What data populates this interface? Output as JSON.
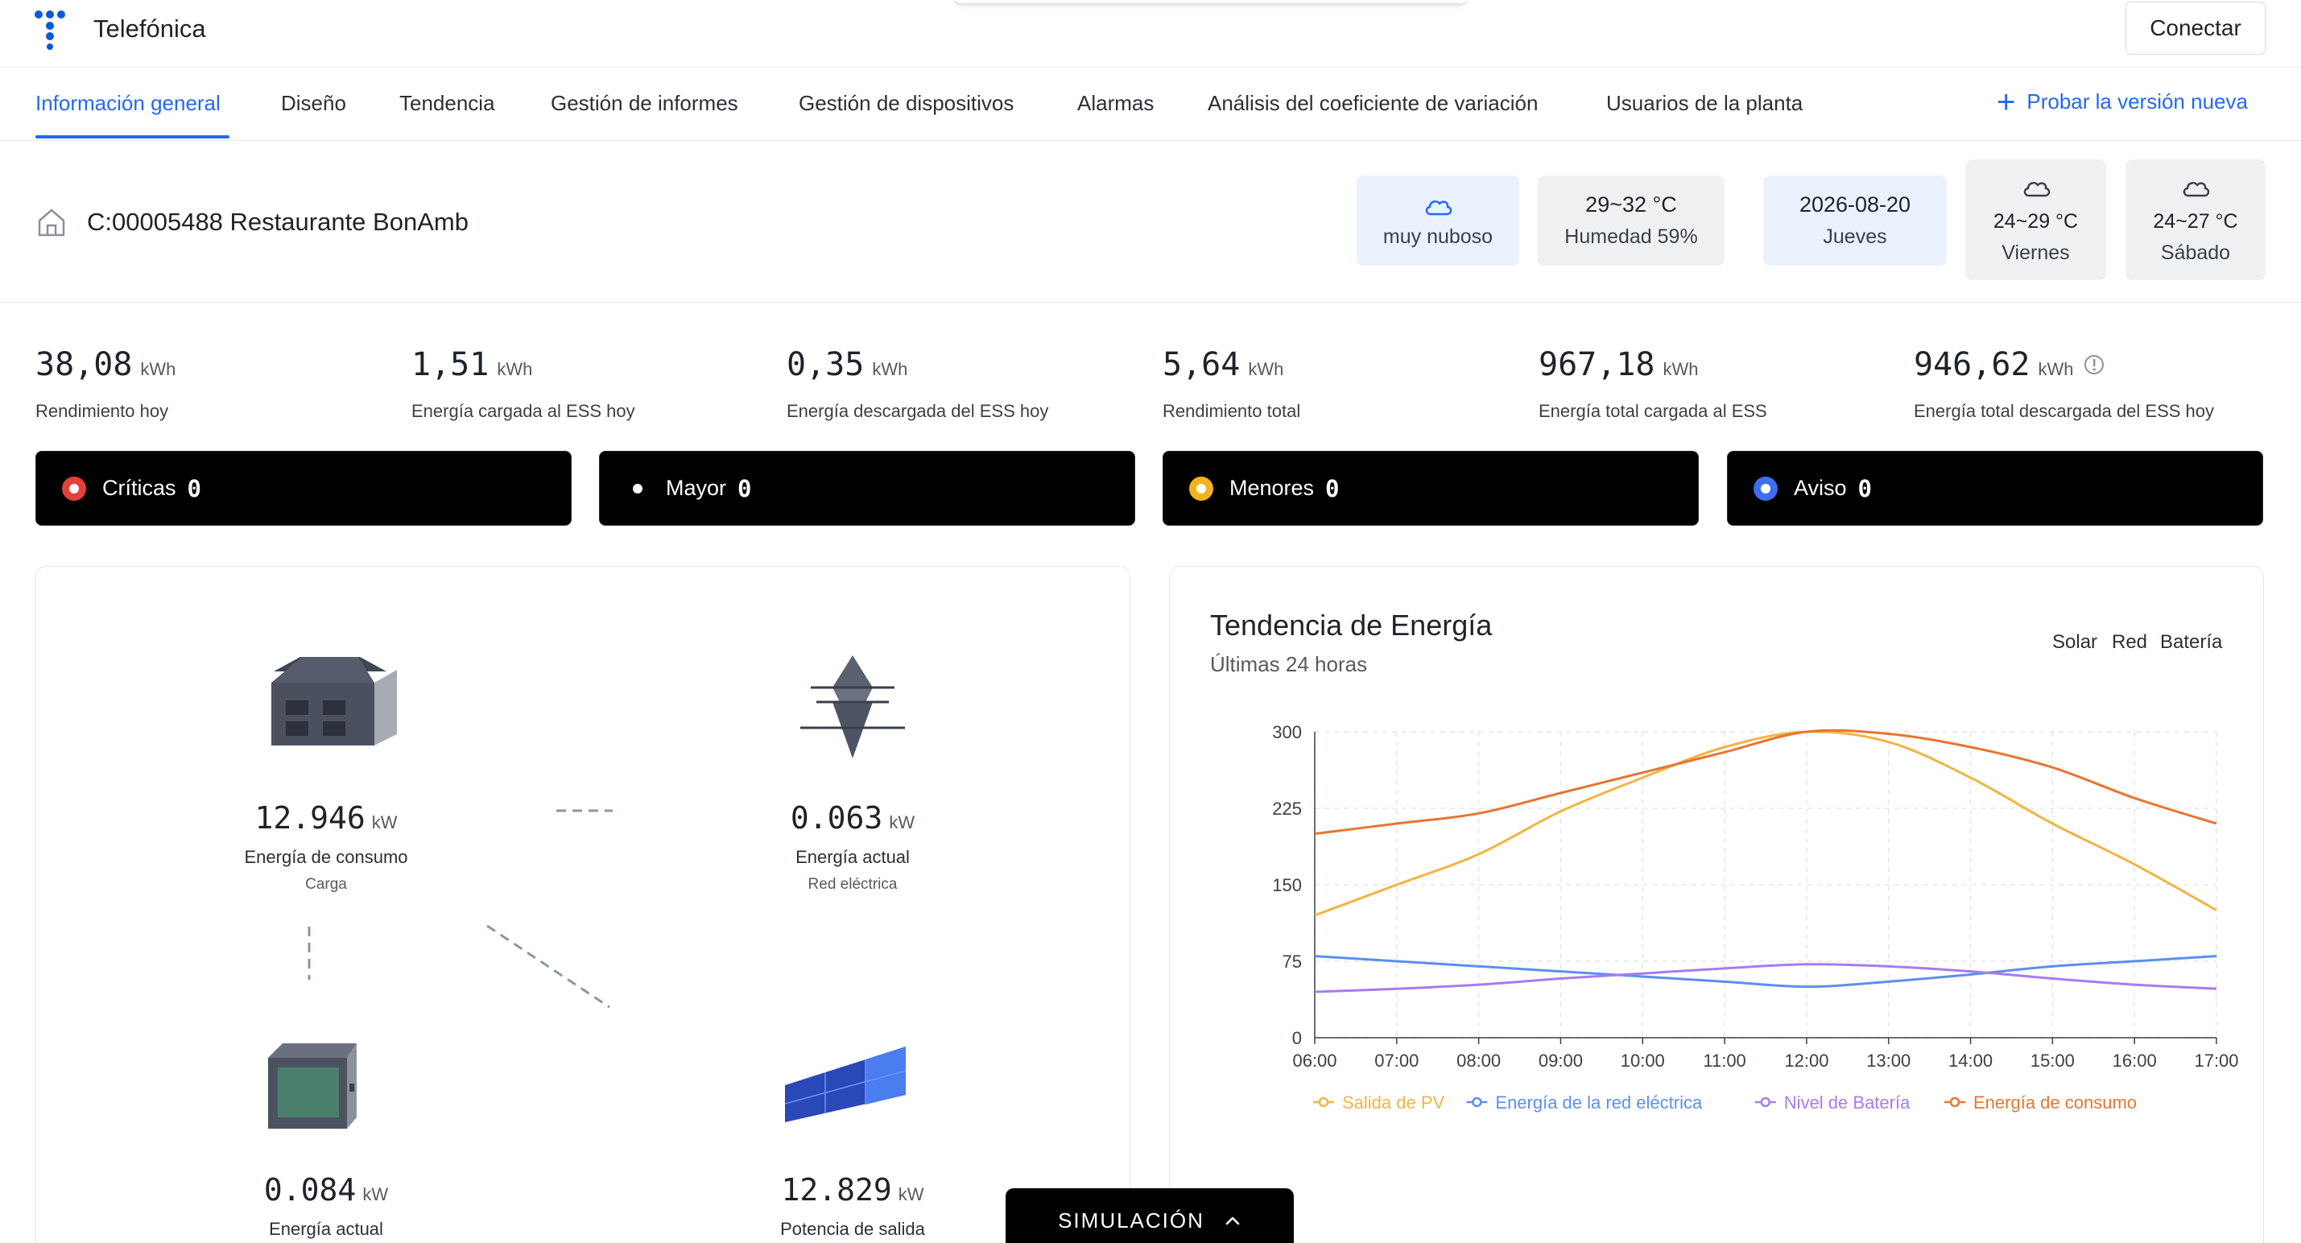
{
  "app": {
    "brand": "Telefónica",
    "connect_label": "Conectar"
  },
  "tabs": [
    {
      "label": "Información general",
      "active": true
    },
    {
      "label": "Diseño"
    },
    {
      "label": "Tendencia"
    },
    {
      "label": "Gestión de informes"
    },
    {
      "label": "Gestión de dispositivos"
    },
    {
      "label": "Alarmas"
    },
    {
      "label": "Análisis del coeficiente de variación"
    },
    {
      "label": "Usuarios de la planta"
    }
  ],
  "try_new_label": "Probar la versión nueva",
  "plant": {
    "name": "C:00005488 Restaurante BonAmb"
  },
  "weather": {
    "today_icon": "cloud-icon",
    "today_condition": "muy nuboso",
    "temp_range": "29~32 °C",
    "humidity": "Humedad 59%",
    "date": "2026-08-20",
    "weekday": "Jueves",
    "forecast": [
      {
        "icon": "cloud-icon",
        "temp": "24~29 °C",
        "day": "Viernes"
      },
      {
        "icon": "cloud-icon",
        "temp": "24~27 °C",
        "day": "Sábado"
      }
    ]
  },
  "stats": [
    {
      "value": "38,08",
      "unit": "kWh",
      "label": "Rendimiento hoy"
    },
    {
      "value": "1,51",
      "unit": "kWh",
      "label": "Energía cargada al ESS hoy"
    },
    {
      "value": "0,35",
      "unit": "kWh",
      "label": "Energía descargada del ESS hoy"
    },
    {
      "value": "5,64",
      "unit": "kWh",
      "label": "Rendimiento total"
    },
    {
      "value": "967,18",
      "unit": "kWh",
      "label": "Energía total cargada al ESS"
    },
    {
      "value": "946,62",
      "unit": "kWh",
      "label": "Energía total descargada del ESS hoy"
    }
  ],
  "alarms": [
    {
      "label": "Críticas",
      "count": "0",
      "color": "#e5403a"
    },
    {
      "label": "Mayor",
      "count": "0",
      "color": "#000000"
    },
    {
      "label": "Menores",
      "count": "0",
      "color": "#f1b21c"
    },
    {
      "label": "Aviso",
      "count": "0",
      "color": "#3d6ff5"
    }
  ],
  "flow": {
    "load": {
      "value": "12.946",
      "unit": "kW",
      "label": "Energía de consumo",
      "sublabel": "Carga"
    },
    "grid": {
      "value": "0.063",
      "unit": "kW",
      "label": "Energía actual",
      "sublabel": "Red eléctrica"
    },
    "battery": {
      "value": "0.084",
      "unit": "kW",
      "label": "Energía actual"
    },
    "pv": {
      "value": "12.829",
      "unit": "kW",
      "label": "Potencia de salida"
    }
  },
  "chart_toggles": [
    "Solar",
    "Red",
    "Batería"
  ],
  "simulation_label": "SIMULACIÓN",
  "chart_data": {
    "type": "line",
    "title": "Tendencia de Energía",
    "subtitle": "Últimas 24 horas",
    "x": [
      "06:00",
      "07:00",
      "08:00",
      "09:00",
      "10:00",
      "11:00",
      "12:00",
      "13:00",
      "14:00",
      "15:00",
      "16:00",
      "17:00"
    ],
    "ylim": [
      0,
      300
    ],
    "yticks": [
      0,
      75,
      150,
      225,
      300
    ],
    "grid": true,
    "legend_position": "bottom",
    "series": [
      {
        "name": "Salida de PV",
        "color": "#f2b441",
        "values": [
          120,
          150,
          180,
          222,
          255,
          285,
          300,
          290,
          255,
          210,
          170,
          125
        ]
      },
      {
        "name": "Energía de la red eléctrica",
        "color": "#5b8ff0",
        "values": [
          80,
          75,
          70,
          65,
          60,
          55,
          50,
          55,
          62,
          70,
          75,
          80
        ]
      },
      {
        "name": "Nivel de Batería",
        "color": "#a57cf0",
        "values": [
          45,
          48,
          52,
          58,
          63,
          68,
          72,
          70,
          65,
          58,
          52,
          48
        ]
      },
      {
        "name": "Energía de consumo",
        "color": "#e87532",
        "values": [
          200,
          210,
          220,
          240,
          260,
          280,
          300,
          298,
          285,
          265,
          235,
          210
        ]
      }
    ]
  }
}
